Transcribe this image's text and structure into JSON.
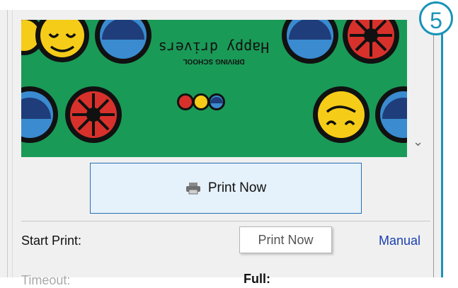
{
  "callout": {
    "number": "5",
    "color": "#1a93b8"
  },
  "preview": {
    "title": "Happy drivers",
    "subtitle": "DRIVING SCHOOL",
    "background": "#1a9a57",
    "orientation": "upside-down"
  },
  "print_button": {
    "label": "Print Now",
    "icon": "printer-icon"
  },
  "tooltip": {
    "text": "Print Now"
  },
  "settings": {
    "start_print_label": "Start Print:",
    "start_print_value": "Manual",
    "timeout_label": "Timeout:",
    "full_label": "Full:"
  },
  "colors": {
    "link": "#1a3fb0",
    "button_bg": "#e5f1fb",
    "button_border": "#2a6fb0"
  }
}
